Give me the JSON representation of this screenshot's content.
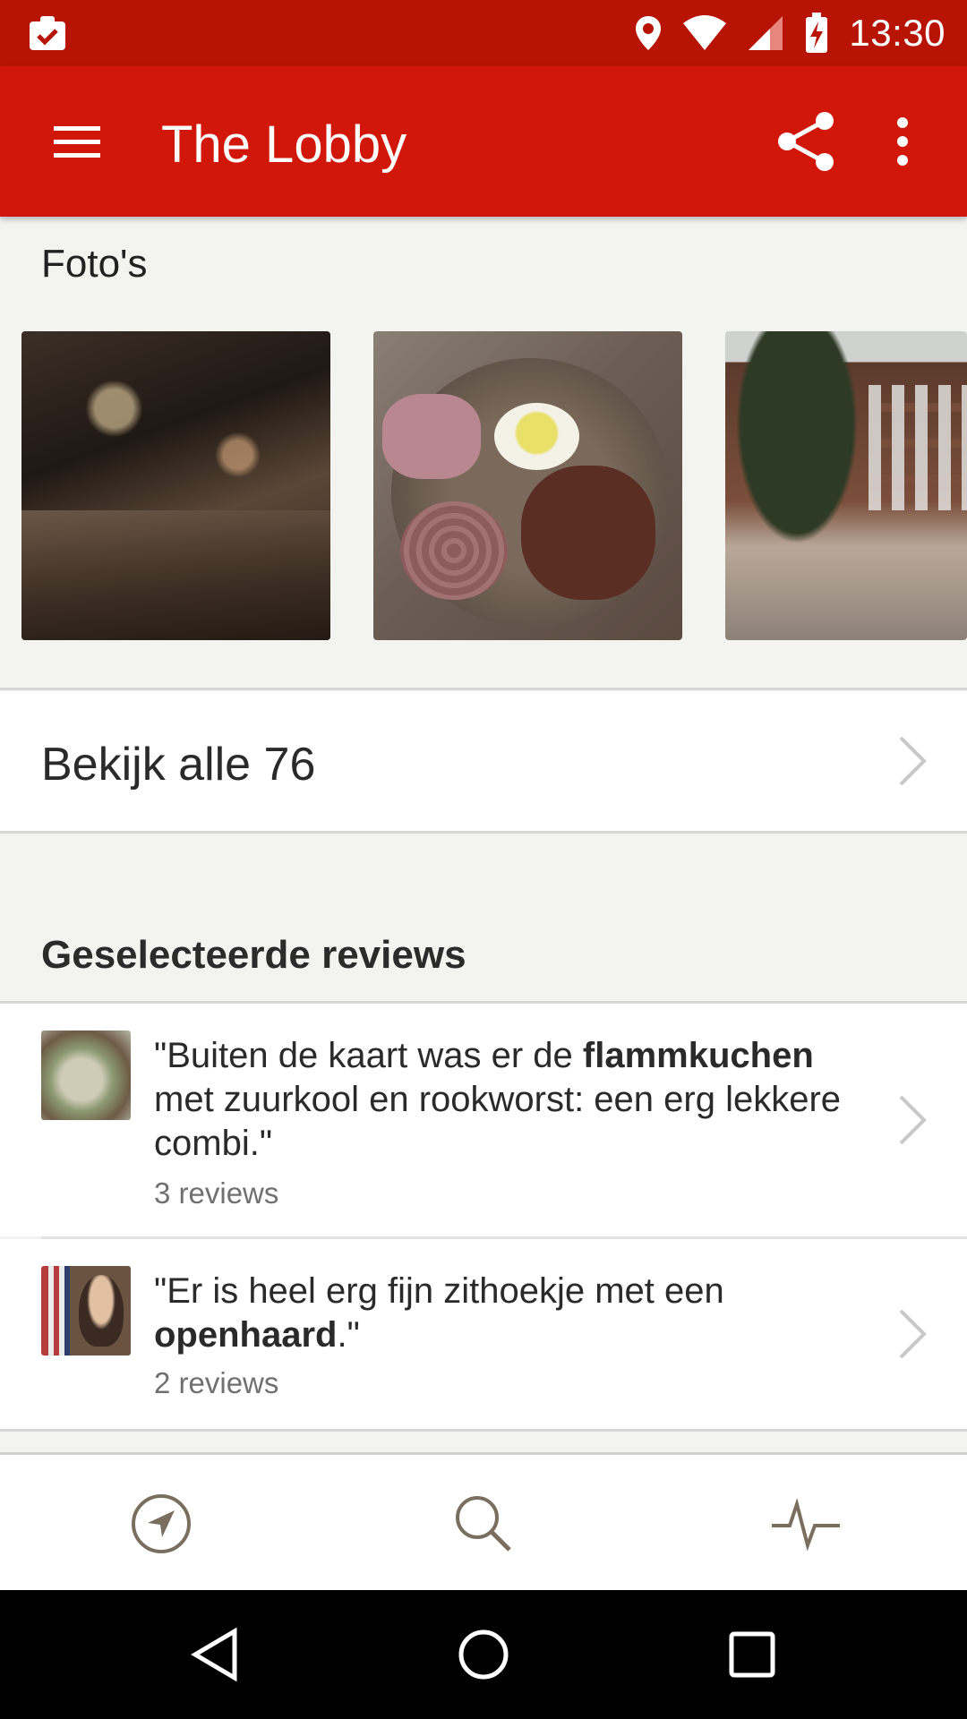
{
  "status_bar": {
    "time": "13:30",
    "icons": [
      "clipboard-check-icon",
      "location-pin-icon",
      "wifi-icon",
      "cell-signal-icon",
      "battery-charging-icon"
    ]
  },
  "app_bar": {
    "title": "The Lobby",
    "background": "#d0170a",
    "icons": [
      "menu-icon",
      "share-icon",
      "overflow-menu-icon"
    ]
  },
  "photos": {
    "title": "Foto's",
    "items": [
      {
        "subject": "restaurant interior"
      },
      {
        "subject": "charcuterie board"
      },
      {
        "subject": "building terrace"
      }
    ]
  },
  "see_all": {
    "label": "Bekijk alle 76"
  },
  "reviews": {
    "title": "Geselecteerde reviews",
    "items": [
      {
        "text_before": "\"Buiten de kaart was er de ",
        "highlight": "flammkuchen",
        "text_after": " met zuurkool en rookworst: een erg lekkere combi.\"",
        "count": "3 reviews"
      },
      {
        "text_before": "\"Er is heel erg fijn zithoekje met een ",
        "highlight": "openhaard",
        "text_after": ".\"",
        "count": "2 reviews"
      }
    ]
  },
  "bottom_nav": {
    "tabs": [
      "navigation-compass-icon",
      "search-icon",
      "activity-pulse-icon"
    ],
    "icon_color": "#7a6f5e"
  },
  "system_nav": {
    "buttons": [
      "back-icon",
      "home-icon",
      "recents-icon"
    ]
  }
}
